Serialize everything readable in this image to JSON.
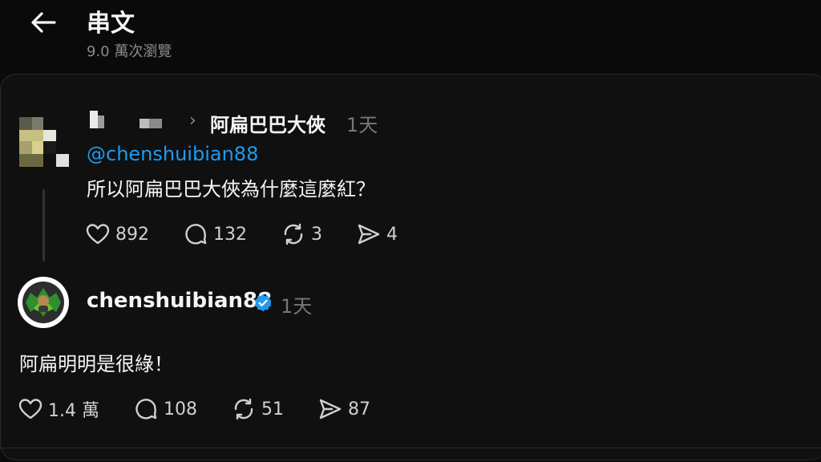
{
  "header": {
    "title": "串文",
    "views": "9.0 萬次瀏覽"
  },
  "post1": {
    "replying_to": "阿扁巴巴大俠",
    "time": "1天",
    "mention": "@chenshuibian88",
    "text": "所以阿扁巴巴大俠為什麼這麼紅？",
    "likes": "892",
    "comments": "132",
    "reposts": "3",
    "shares": "4"
  },
  "post2": {
    "username": "chenshuibian88",
    "time": "1天",
    "text": "阿扁明明是很綠！",
    "likes": "1.4 萬",
    "comments": "108",
    "reposts": "51",
    "shares": "87"
  },
  "colors": {
    "background": "#0a0a0a",
    "card": "#101010",
    "link": "#1d9bf0",
    "verified": "#1d9bf0",
    "muted": "#777777"
  }
}
